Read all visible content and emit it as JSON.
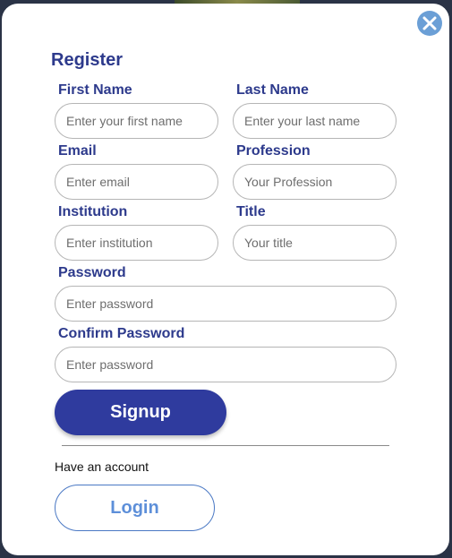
{
  "form": {
    "title": "Register",
    "first_name": {
      "label": "First Name",
      "placeholder": "Enter your first name"
    },
    "last_name": {
      "label": "Last Name",
      "placeholder": "Enter your last name"
    },
    "email": {
      "label": "Email",
      "placeholder": "Enter email"
    },
    "profession": {
      "label": "Profession",
      "placeholder": "Your Profession"
    },
    "institution": {
      "label": "Institution",
      "placeholder": "Enter institution"
    },
    "title_field": {
      "label": "Title",
      "placeholder": "Your title"
    },
    "password": {
      "label": "Password",
      "placeholder": "Enter password"
    },
    "confirm_password": {
      "label": "Confirm Password",
      "placeholder": "Enter password"
    },
    "signup_label": "Signup",
    "have_account_text": "Have an account",
    "login_label": "Login"
  },
  "colors": {
    "accent": "#2f3b9e",
    "label": "#2d3a8c",
    "close_button": "#6b9fd6",
    "login_text": "#5d8fd9"
  },
  "icons": {
    "close": "close-icon"
  }
}
